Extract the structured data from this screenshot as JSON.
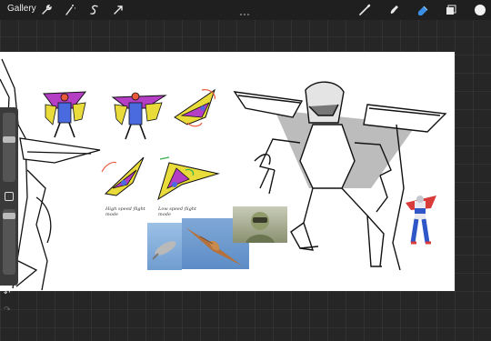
{
  "toolbar": {
    "gallery_label": "Gallery",
    "left_tools": [
      "wrench-icon",
      "magic-wand-icon",
      "selection-icon",
      "transform-icon"
    ],
    "right_tools": [
      "brush-icon",
      "smudge-icon",
      "eraser-icon",
      "layers-icon",
      "color-icon"
    ],
    "active_tool": "eraser-icon",
    "accent": "#3a8ee6",
    "current_color": "#f2f2f2"
  },
  "canvas": {
    "captions": {
      "left": "High speed flight mode",
      "right": "Low speed flight mode"
    }
  },
  "sidebar": {
    "undo_icon": "↶",
    "redo_icon": "↷"
  },
  "references": [
    "airplane-photo",
    "bird-photo",
    "pilot-photo",
    "robot-figure"
  ]
}
